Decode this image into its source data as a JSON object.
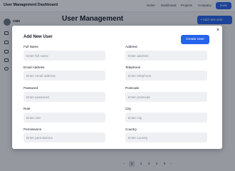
{
  "app": {
    "title": "User Management Dashboard"
  },
  "nav": {
    "items": [
      "Home",
      "Dashboard",
      "Projects",
      "Company"
    ],
    "invite_label": "Invite"
  },
  "sidebar": {
    "brand": "CMS"
  },
  "page": {
    "title": "User Management",
    "add_button_label": "Add new user"
  },
  "pagination": {
    "pages": [
      "1",
      "2",
      "3",
      "4",
      "5"
    ],
    "current": "1",
    "prev": "‹",
    "next": "›"
  },
  "modal": {
    "title": "Add New User",
    "close_label": "×",
    "create_label": "Create User",
    "fields": [
      {
        "label": "Full Name",
        "placeholder": "Enter full name"
      },
      {
        "label": "Address",
        "placeholder": "Enter address"
      },
      {
        "label": "Email Address",
        "placeholder": "Enter email address"
      },
      {
        "label": "Telephone",
        "placeholder": "Enter telephone"
      },
      {
        "label": "Password",
        "placeholder": "Enter password"
      },
      {
        "label": "Postcode",
        "placeholder": "Enter postcode"
      },
      {
        "label": "Role",
        "placeholder": "Enter role"
      },
      {
        "label": "City",
        "placeholder": "Enter city"
      },
      {
        "label": "Permissions",
        "placeholder": "Enter permissions"
      },
      {
        "label": "Country",
        "placeholder": "Enter country"
      }
    ]
  },
  "colors": {
    "accent": "#2563eb",
    "overlay": "#111827",
    "input_bg": "#eef0f3"
  }
}
